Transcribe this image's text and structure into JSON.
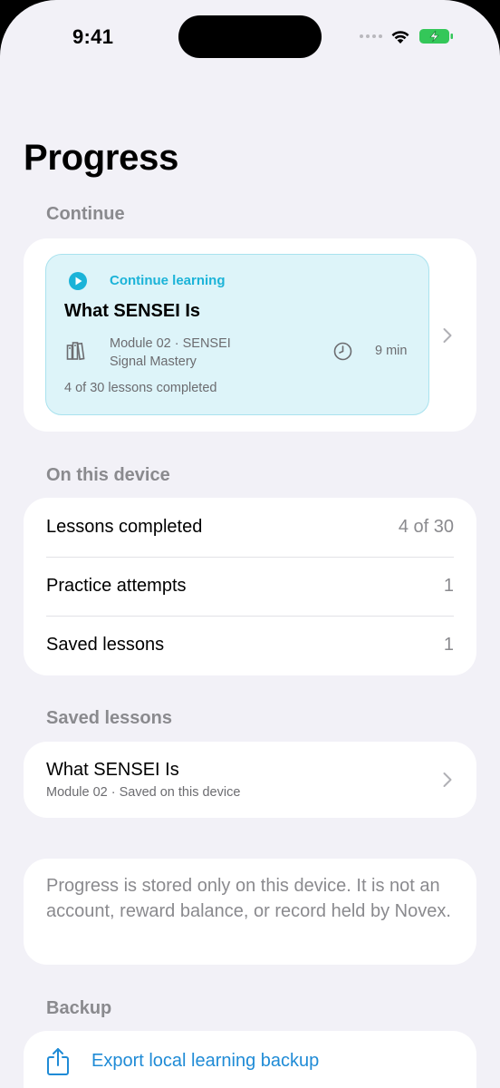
{
  "status_bar": {
    "time": "9:41"
  },
  "page": {
    "title": "Progress"
  },
  "continue_section": {
    "header": "Continue",
    "label": "Continue learning",
    "lesson_title": "What SENSEI Is",
    "module_line1": "Module 02 · SENSEI",
    "module_line2": "Signal Mastery",
    "duration": "9 min",
    "progress": "4 of 30 lessons completed"
  },
  "device_section": {
    "header": "On this device",
    "rows": [
      {
        "label": "Lessons completed",
        "value": "4 of 30"
      },
      {
        "label": "Practice attempts",
        "value": "1"
      },
      {
        "label": "Saved lessons",
        "value": "1"
      }
    ]
  },
  "saved_section": {
    "header": "Saved lessons",
    "items": [
      {
        "title": "What SENSEI Is",
        "subtitle": "Module 02 · Saved on this device"
      }
    ]
  },
  "notice": {
    "text": "Progress is stored only on this device. It is not an account, reward balance, or record held by Novex."
  },
  "backup_section": {
    "header": "Backup",
    "export_label": "Export local learning backup"
  },
  "colors": {
    "accent_cyan": "#1bb3d8",
    "link_blue": "#1f8bd6",
    "battery_green": "#34c759",
    "background": "#f2f1f7"
  },
  "icons": [
    "play-icon",
    "books-icon",
    "clock-icon",
    "chevron-right-icon",
    "share-icon",
    "wifi-icon",
    "battery-icon",
    "signal-icon"
  ]
}
